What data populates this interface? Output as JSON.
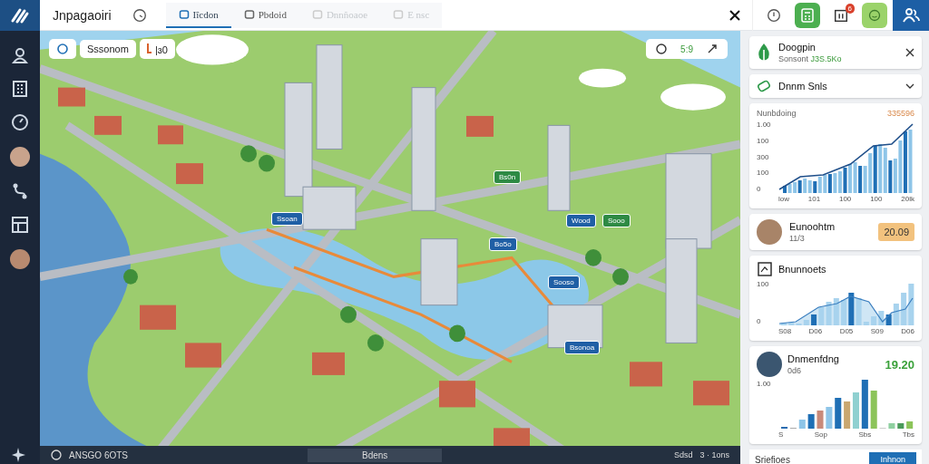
{
  "app_title": "Jnpagaoiri",
  "tabs": [
    {
      "label": "Iîcdon",
      "selected": true,
      "disabled": false
    },
    {
      "label": "Pbdoid",
      "selected": false,
      "disabled": false
    },
    {
      "label": "Dnnñoaoe",
      "selected": false,
      "disabled": true
    },
    {
      "label": "E nsc",
      "selected": false,
      "disabled": true
    }
  ],
  "notification_badge": "6",
  "map_toolbar": {
    "chip_label": "Sssonom",
    "chip_reading": "|ɜ0",
    "time": "5:9"
  },
  "map_pins": [
    {
      "label": "Ssoan"
    },
    {
      "label": "Bs0n"
    },
    {
      "label": "Bo5o"
    },
    {
      "label": "Wood"
    },
    {
      "label": "Sooo"
    },
    {
      "label": "Sooso"
    },
    {
      "label": "Bsonoa"
    }
  ],
  "status_bar": {
    "code": "ANSGO 6OTS",
    "center": "Bdens",
    "right_label": "Sdsd",
    "right_count": "3 · 1ons"
  },
  "notice": {
    "title": "Doogpin",
    "subtitle": "Sonsont",
    "amount": "J3S.5Ko"
  },
  "dropdown": {
    "label": "Dnnm Snls",
    "expanded": false
  },
  "chart_card": {
    "title": "Nunbdoing",
    "total": "335596",
    "yticks": [
      "1.00",
      "100",
      "300",
      "100",
      "0"
    ],
    "xticks": [
      "low",
      "101",
      "100",
      "100",
      "20lk"
    ]
  },
  "item_card": {
    "title": "Eunoohtm",
    "subtitle": "11/3",
    "badge": "20.09"
  },
  "chart_card_2": {
    "title": "Bnunnoets",
    "yticks": [
      "100",
      "0"
    ],
    "xticks": [
      "S08",
      "D06",
      "D05",
      "S09",
      "D06"
    ]
  },
  "chart_card_3": {
    "title": "Dnmenfdng",
    "subtitle": "0d6",
    "amount": "19.20",
    "yticks": [
      "1.00"
    ],
    "xticks": [
      "S",
      "Sop",
      "Sbs",
      "Tbs"
    ]
  },
  "footer": {
    "label": "Sriefioes",
    "button": "Inhnon"
  }
}
